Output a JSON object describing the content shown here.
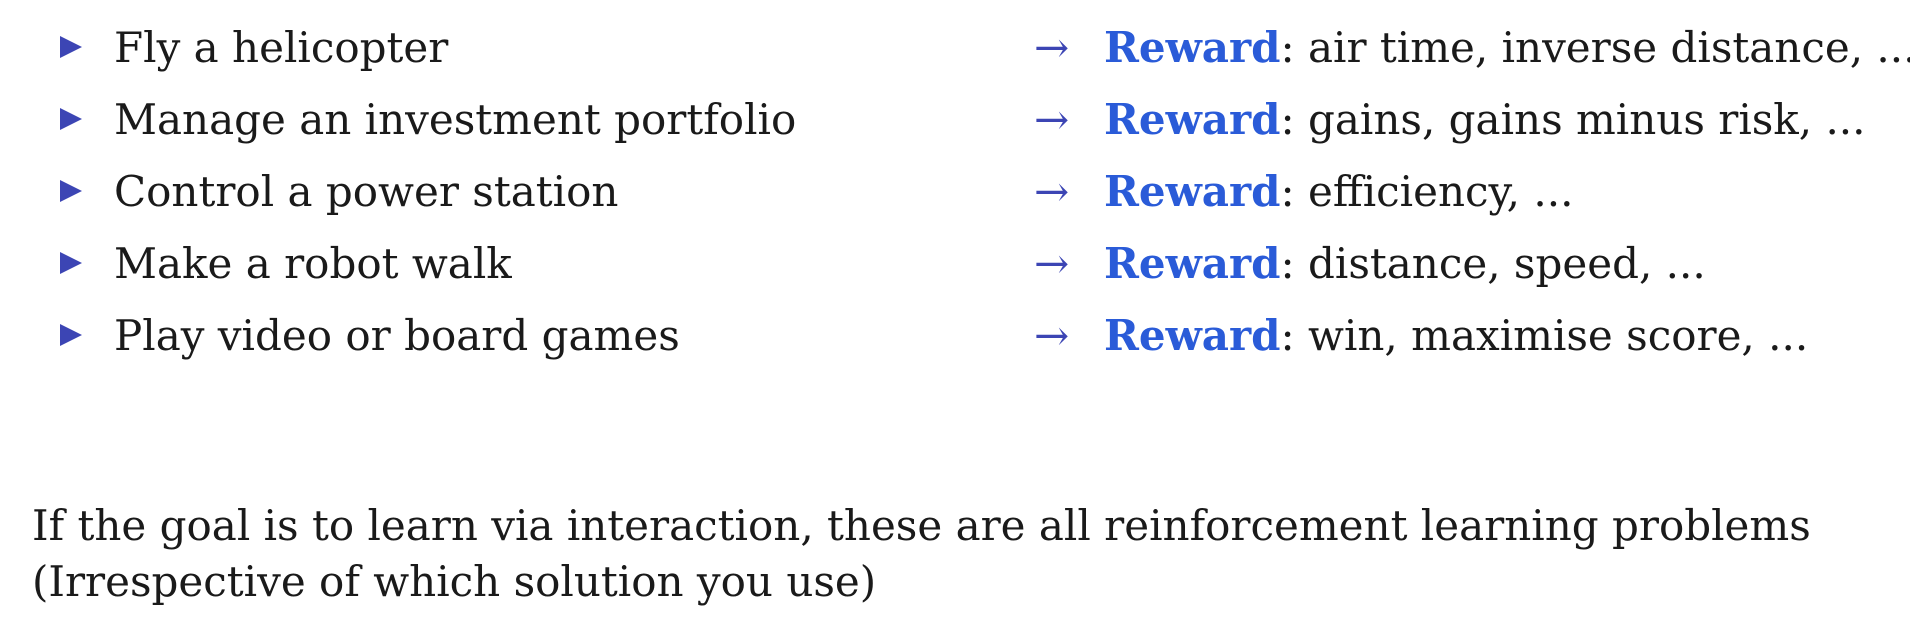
{
  "colors": {
    "bullet": "#3c45b4",
    "reward": "#2a5bd8",
    "text": "#1a1a1a"
  },
  "items": [
    {
      "task": "Fly a helicopter",
      "arrow": "→",
      "keyword": "Reward",
      "detail": ": air time, inverse distance, ..."
    },
    {
      "task": "Manage an investment portfolio",
      "arrow": "→",
      "keyword": "Reward",
      "detail": ": gains, gains minus risk, ..."
    },
    {
      "task": "Control a power station",
      "arrow": "→",
      "keyword": "Reward",
      "detail": ": efficiency, ..."
    },
    {
      "task": "Make a robot walk",
      "arrow": "→",
      "keyword": "Reward",
      "detail": ": distance, speed, ..."
    },
    {
      "task": "Play video or board games",
      "arrow": "→",
      "keyword": "Reward",
      "detail": ": win, maximise score, ..."
    }
  ],
  "footer": {
    "line1": "If the goal is to learn via interaction, these are all reinforcement learning problems",
    "line2": "(Irrespective of which solution you use)"
  }
}
